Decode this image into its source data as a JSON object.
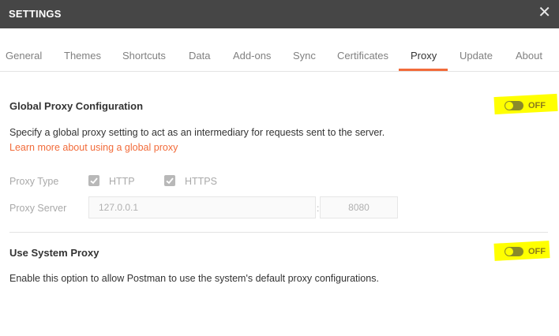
{
  "window": {
    "title": "SETTINGS",
    "close_glyph": "✕"
  },
  "tabs": [
    {
      "label": "General"
    },
    {
      "label": "Themes"
    },
    {
      "label": "Shortcuts"
    },
    {
      "label": "Data"
    },
    {
      "label": "Add-ons"
    },
    {
      "label": "Sync"
    },
    {
      "label": "Certificates"
    },
    {
      "label": "Proxy",
      "active": true
    },
    {
      "label": "Update"
    },
    {
      "label": "About"
    }
  ],
  "global_proxy": {
    "title": "Global Proxy Configuration",
    "toggle_label": "OFF",
    "toggle_on": false,
    "description": "Specify a global proxy setting to act as an intermediary for requests sent to the server.",
    "learn_more": "Learn more about using a global proxy",
    "proxy_type_label": "Proxy Type",
    "http_label": "HTTP",
    "http_checked": true,
    "https_label": "HTTPS",
    "https_checked": true,
    "proxy_server_label": "Proxy Server",
    "server_value": "127.0.0.1",
    "port_separator": ":",
    "port_value": "8080"
  },
  "system_proxy": {
    "title": "Use System Proxy",
    "toggle_label": "OFF",
    "toggle_on": false,
    "description": "Enable this option to allow Postman to use the system's default proxy configurations."
  },
  "colors": {
    "titlebar": "#464646",
    "accent": "#f26b3a",
    "highlight": "#ffff00"
  }
}
